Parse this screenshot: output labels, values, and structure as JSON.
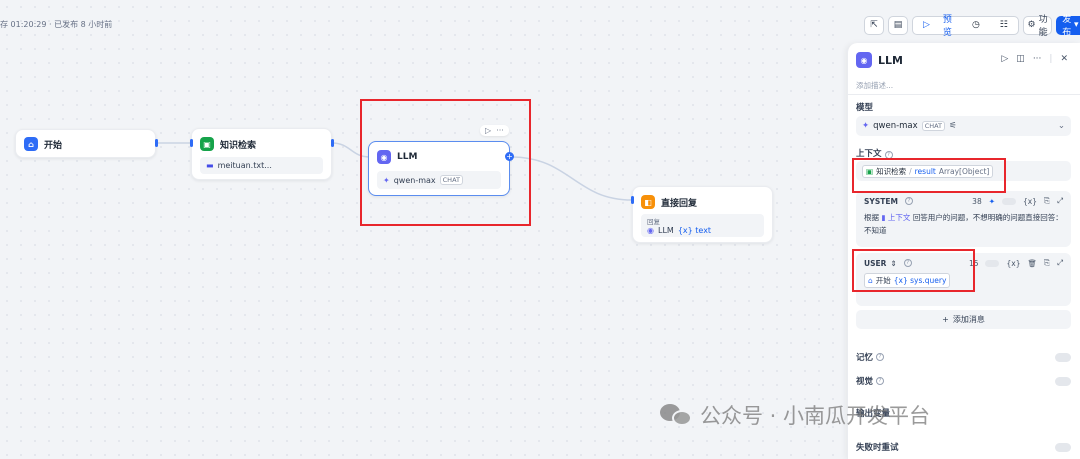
{
  "canvas": {
    "status": "存 01:20:29 · 已发布 8 小时前"
  },
  "toolbar": {
    "preview_label": "预览",
    "features_label": "功能",
    "publish_label": "发布"
  },
  "nodes": {
    "start": {
      "title": "开始"
    },
    "knowledge": {
      "title": "知识检索",
      "dataset": "meituan.txt..."
    },
    "llm": {
      "title": "LLM",
      "model": "qwen-max",
      "tag": "CHAT"
    },
    "answer": {
      "title": "直接回复",
      "field_label": "回复",
      "ref_node": "LLM",
      "ref_var": "{x} text"
    }
  },
  "panel": {
    "title": "LLM",
    "description_placeholder": "添加描述...",
    "model_label": "模型",
    "model_name": "qwen-max",
    "model_tag": "CHAT",
    "context_label": "上下文",
    "context_node": "知识检索",
    "context_var": "result",
    "context_type": "Array[Object]",
    "system": {
      "label": "SYSTEM",
      "count": "38",
      "text_before": "根据",
      "text_ref": "上下文",
      "text_after": "回答用户的问题，不想明确的问题直接回答：不知道"
    },
    "user": {
      "label": "USER",
      "count": "15",
      "ref_node": "开始",
      "ref_var": "{x} sys.query"
    },
    "add_message_label": "添加消息",
    "memory_label": "记忆",
    "vision_label": "视觉",
    "output_label": "输出变量",
    "retry_label": "失败时重试"
  },
  "watermark": {
    "text": "公众号 · 小南瓜开发平台"
  },
  "colors": {
    "accent": "#155eef",
    "highlight": "#e8262c"
  }
}
